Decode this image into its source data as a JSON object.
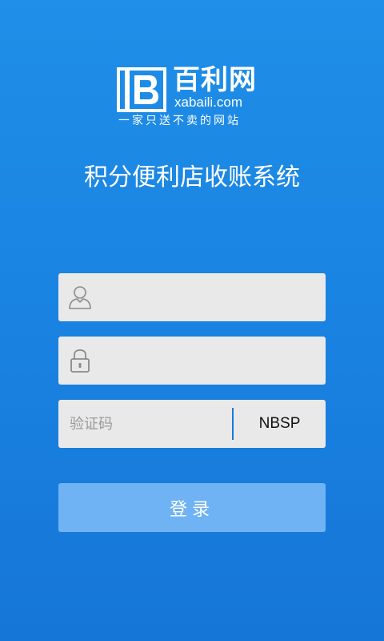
{
  "logo": {
    "brand": "百利网",
    "domain": "xabaili.com",
    "slogan": "一家只送不卖的网站",
    "mark_letter": "B"
  },
  "app_title": "积分便利店收账系统",
  "form": {
    "username": {
      "value": "",
      "placeholder": "",
      "icon": "user-icon"
    },
    "password": {
      "value": "",
      "placeholder": "",
      "icon": "lock-icon"
    },
    "captcha": {
      "value": "",
      "placeholder": "验证码",
      "code": "NBSP"
    },
    "login_label": "登录"
  },
  "colors": {
    "background_top": "#1f8fe8",
    "background_bottom": "#1676d8",
    "field_bg": "#e9e9e9",
    "button_bg": "#6fb3f4",
    "divider": "#1a7ad9"
  }
}
